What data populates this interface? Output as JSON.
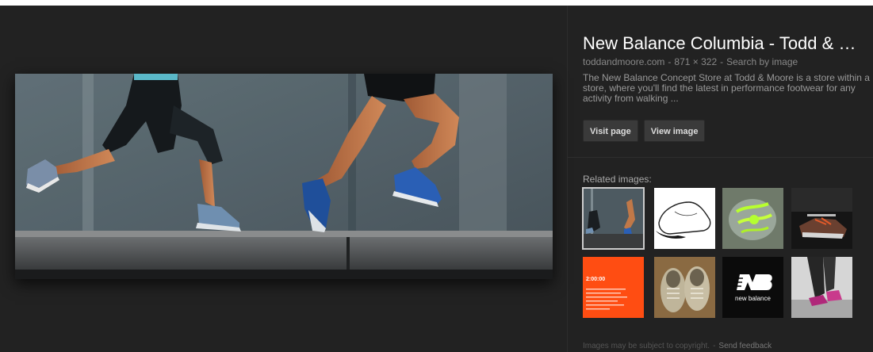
{
  "result": {
    "title": "New Balance Columbia - Todd & Moo...",
    "source": "toddandmoore.com",
    "dimensions": "871 × 322",
    "search_by_image": "Search by image",
    "separator": "-",
    "description": "The New Balance Concept Store at Todd & Moore is a store within a store, where you'll find the latest in performance footwear for any activity from walking ...",
    "buttons": {
      "visit_page": "Visit page",
      "view_image": "View image"
    }
  },
  "related": {
    "label": "Related images:",
    "items": [
      {
        "name": "runners-wall",
        "selected": true
      },
      {
        "name": "shoe-sketch"
      },
      {
        "name": "neon-laces"
      },
      {
        "name": "shoes-box-dark"
      },
      {
        "name": "orange-flyer",
        "text": "2:00:00"
      },
      {
        "name": "worn-sneakers"
      },
      {
        "name": "new-balance-logo",
        "text": "new balance"
      },
      {
        "name": "pink-shoe-walk"
      }
    ]
  },
  "footer": {
    "copyright": "Images may be subject to copyright.",
    "separator": "-",
    "feedback": "Send feedback"
  },
  "colors": {
    "background": "#222222",
    "accent_text": "#ffffff",
    "button": "#3a3a3a"
  }
}
